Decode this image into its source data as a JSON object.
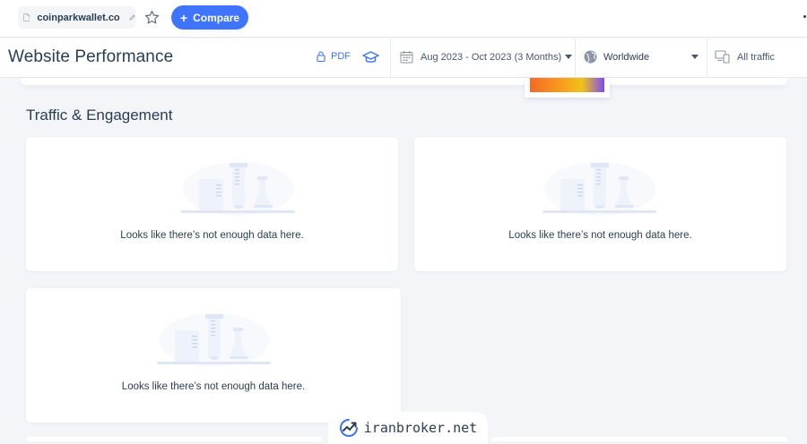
{
  "topbar": {
    "site_name": "coinparkwallet.co",
    "compare_label": "Compare"
  },
  "header": {
    "title": "Website Performance",
    "pdf_label": "PDF",
    "date_range": "Aug 2023 - Oct 2023 (3 Months)",
    "geo": "Worldwide",
    "traffic": "All traffic"
  },
  "section": {
    "title": "Traffic & Engagement"
  },
  "cards": [
    {
      "message": "Looks like there’s not enough data here."
    },
    {
      "message": "Looks like there’s not enough data here."
    },
    {
      "message": "Looks like there’s not enough data here."
    }
  ],
  "watermark": {
    "text": "iranbroker.net"
  },
  "colors": {
    "accent": "#3e74fe",
    "page_bg": "#f3f5f9",
    "text": "#2a3e52"
  },
  "icons": [
    "doc-icon",
    "pencil-icon",
    "star-icon",
    "plus-icon",
    "lock-icon",
    "graduation-cap-icon",
    "calendar-icon",
    "globe-icon",
    "devices-icon",
    "no-data-illustration",
    "trend-logo-icon"
  ]
}
